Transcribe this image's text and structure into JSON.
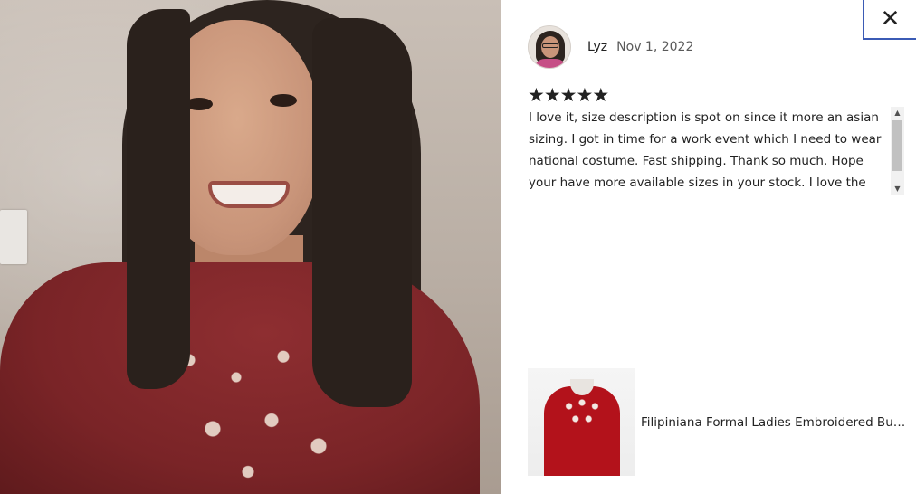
{
  "close": {
    "icon": "close-icon",
    "glyph": "✕"
  },
  "reviewer": {
    "name": "Lyz",
    "date": "Nov 1, 2022",
    "avatar_icon": "avatar"
  },
  "rating": {
    "stars": 5,
    "max": 5,
    "glyph": "★"
  },
  "review": {
    "text": "I love it, size description is spot on since it more an asian sizing. I got in time for a work event which I need to wear national costume. Fast shipping. Thank so much. Hope your have more available sizes in your stock. I love the tops"
  },
  "scrollbar": {
    "up_glyph": "▲",
    "down_glyph": "▼"
  },
  "product": {
    "title": "Filipiniana Formal Ladies Embroidered Burgundy Blouse"
  },
  "colors": {
    "text": "#222222",
    "muted": "#595959",
    "close_border": "#3b5bb5",
    "blouse": "#7a2427",
    "product_dress": "#b3121b"
  }
}
